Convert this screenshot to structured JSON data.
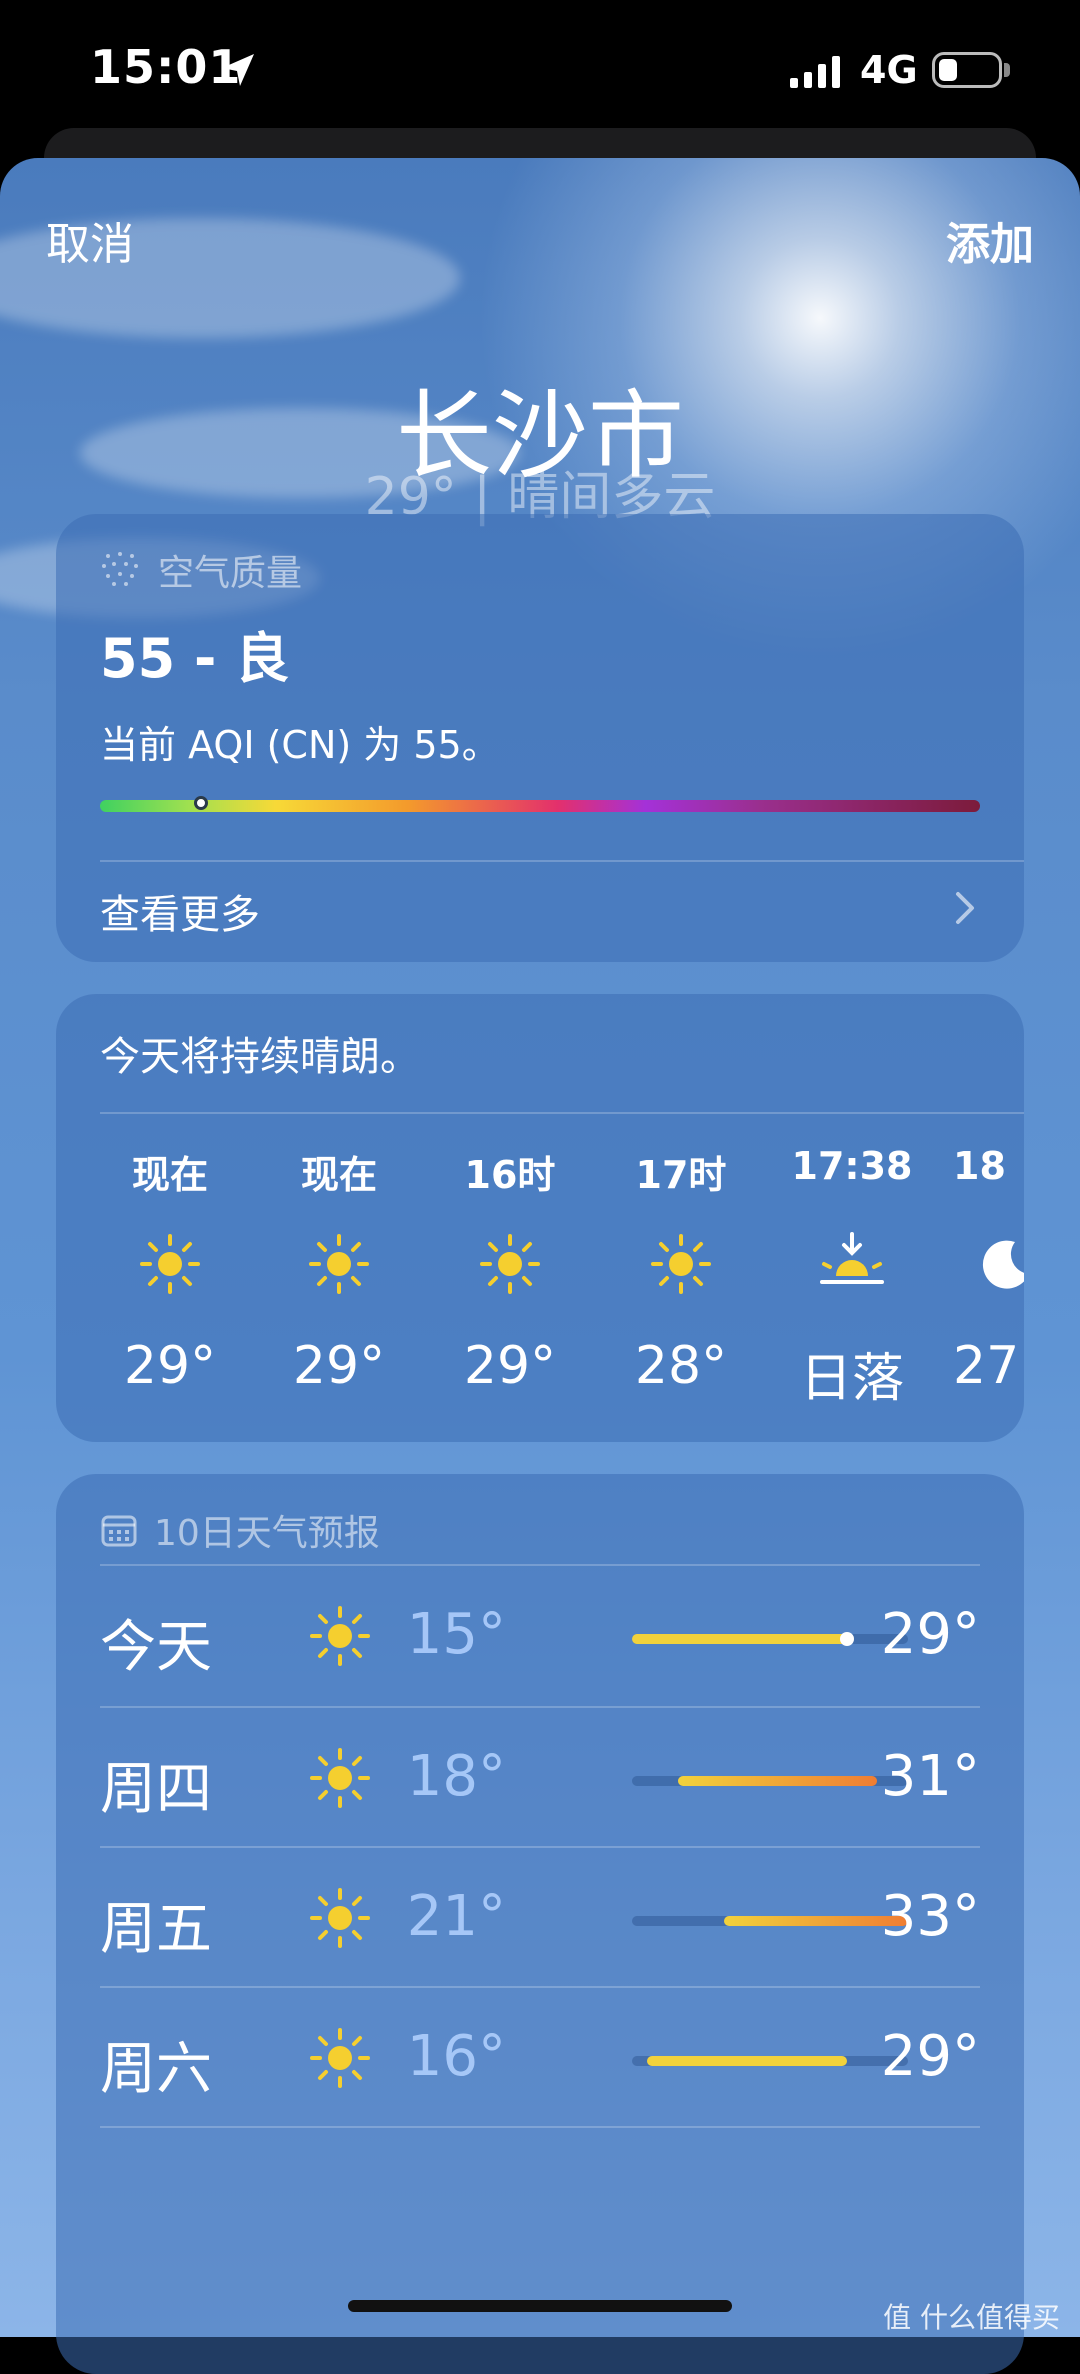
{
  "status_bar": {
    "time": "15:01",
    "network": "4G"
  },
  "nav": {
    "cancel": "取消",
    "add": "添加"
  },
  "location": {
    "city": "长沙市",
    "summary": "29° | 晴间多云"
  },
  "aqi": {
    "header": "空气质量",
    "value_text": "55 - 良",
    "description": "当前 AQI (CN) 为 55。",
    "scale_position": 0.115,
    "more": "查看更多"
  },
  "hourly": {
    "summary": "今天将持续晴朗。",
    "items": [
      {
        "time": "现在",
        "icon": "sun-icon",
        "temp": "29°"
      },
      {
        "time": "现在",
        "icon": "sun-icon",
        "temp": "29°"
      },
      {
        "time": "16时",
        "icon": "sun-icon",
        "temp": "29°"
      },
      {
        "time": "17时",
        "icon": "sun-icon",
        "temp": "28°"
      },
      {
        "time": "17:38",
        "icon": "sunset-icon",
        "temp": "日落"
      },
      {
        "time": "18",
        "icon": "moon-icon",
        "temp": "27"
      }
    ]
  },
  "forecast": {
    "header": "10日天气预报",
    "range": [
      15,
      33
    ],
    "days": [
      {
        "day": "今天",
        "icon": "sun-icon",
        "low": "15°",
        "high": "29°",
        "low_value": 15,
        "high_value": 29,
        "current": 29
      },
      {
        "day": "周四",
        "icon": "sun-icon",
        "low": "18°",
        "high": "31°",
        "low_value": 18,
        "high_value": 31
      },
      {
        "day": "周五",
        "icon": "sun-icon",
        "low": "21°",
        "high": "33°",
        "low_value": 21,
        "high_value": 33
      },
      {
        "day": "周六",
        "icon": "sun-icon",
        "low": "16°",
        "high": "29°",
        "low_value": 16,
        "high_value": 29
      }
    ]
  },
  "colors": {
    "bar_cool": "#f2d23c",
    "bar_warm": "#ef7d33"
  },
  "watermark": "值 什么值得买"
}
